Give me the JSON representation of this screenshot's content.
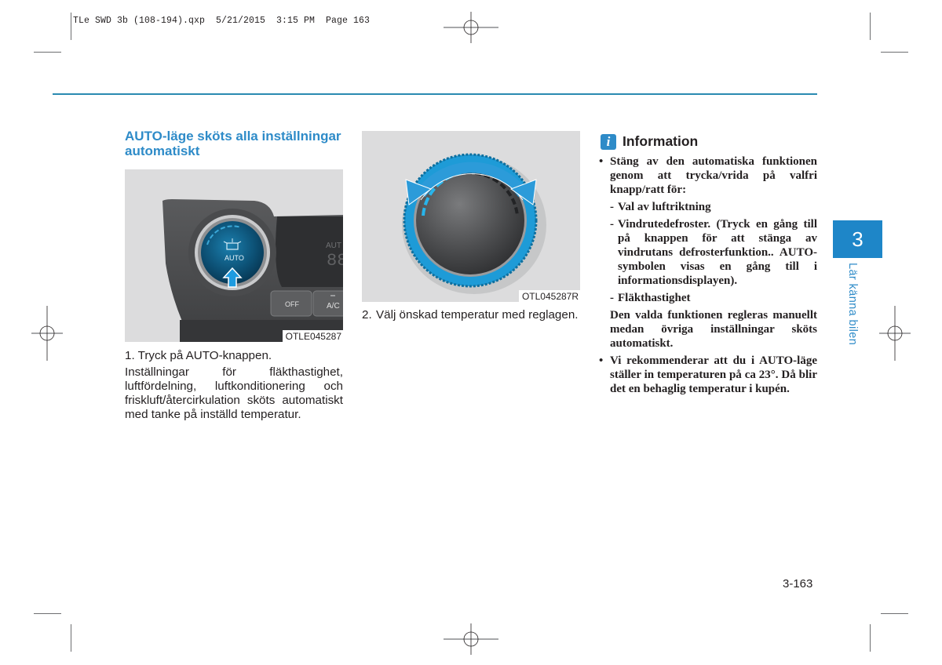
{
  "slug": "TLe SWD 3b (108-194).qxp  5/21/2015  3:15 PM  Page 163",
  "colors": {
    "accent": "#2e8bc8",
    "rule": "#2a8ab1",
    "chapter_tab": "#1e86c8"
  },
  "section": {
    "title": "AUTO-läge sköts alla inställningar automatiskt"
  },
  "figure1": {
    "label": "OTLE045287",
    "button_text": "AUTO",
    "off_label": "OFF",
    "ac_label": "A/C",
    "display_text": "AUT",
    "display_digits": "88",
    "icons": [
      "defrost-auto-icon",
      "press-arrow-icon"
    ]
  },
  "step1": {
    "heading": "1. Tryck på AUTO-knappen.",
    "body": "Inställningar för fläkthastighet, luftfördelning, luftkonditionering och friskluft/återcirkulation sköts automatiskt med tanke på inställd temperatur."
  },
  "figure2": {
    "label": "OTL045287R",
    "icons": [
      "rotate-arrows-icon",
      "temperature-knob"
    ]
  },
  "step2": {
    "number": "2.",
    "text": "Välj önskad temperatur med reglagen."
  },
  "info": {
    "title": "Information",
    "icon": "info-icon",
    "bullet1": "Stäng av den automatiska funktionen genom att trycka/vrida på valfri knapp/ratt för:",
    "sub1": "Val av luftriktning",
    "sub2": "Vindrutedefroster. (Tryck en gång till på knappen för att stänga av vindrutans defrosterfunktion.. AUTO-symbolen visas en gång till i informationsdisplayen).",
    "sub3": "Fläkthastighet",
    "sub3_note": "Den valda funktionen regleras manuellt medan övriga inställningar sköts automatiskt.",
    "bullet2": "Vi rekommenderar att du i AUTO-läge ställer in temperaturen på ca 23°. Då blir det en behaglig temperatur i kupén."
  },
  "chapter": {
    "number": "3",
    "label": "Lär känna bilen"
  },
  "page_number": "3-163"
}
